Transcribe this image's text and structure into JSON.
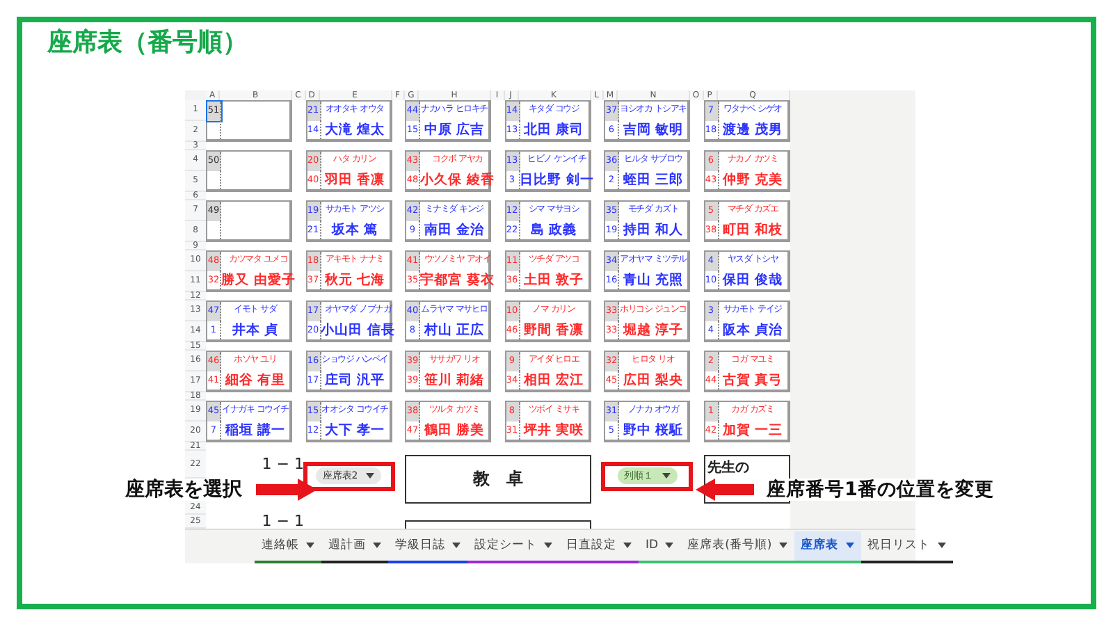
{
  "title": "座席表（番号順）",
  "sheet": {
    "columns": [
      "A",
      "B",
      "C",
      "D",
      "E",
      "F",
      "G",
      "H",
      "I",
      "J",
      "K",
      "L",
      "M",
      "N",
      "O",
      "P",
      "Q"
    ],
    "row_numbers": [
      "1",
      "2",
      "3",
      "4",
      "5",
      "6",
      "7",
      "8",
      "9",
      "10",
      "11",
      "12",
      "13",
      "14",
      "15",
      "16",
      "17",
      "18",
      "19",
      "20",
      "21",
      "22",
      "24",
      "25"
    ],
    "seat_columns": [
      {
        "seats": [
          {
            "kind": "empty",
            "seat_no": "51"
          },
          {
            "kind": "empty",
            "seat_no": "50"
          },
          {
            "kind": "empty",
            "seat_no": "49"
          },
          {
            "kind": "student",
            "seat_no": "48",
            "kana": "カツマタ ユメコ",
            "name": "勝又 由愛子",
            "student_no": "32",
            "color": "#ff2a2a"
          },
          {
            "kind": "student",
            "seat_no": "47",
            "kana": "イモト サダ",
            "name": "井本 貞",
            "student_no": "1",
            "color": "#2b33ff"
          },
          {
            "kind": "student",
            "seat_no": "46",
            "kana": "ホソヤ ユリ",
            "name": "細谷 有里",
            "student_no": "41",
            "color": "#ff2a2a"
          },
          {
            "kind": "student",
            "seat_no": "45",
            "kana": "イナガキ コウイチ",
            "name": "稲垣 講一",
            "student_no": "7",
            "color": "#2b33ff"
          }
        ]
      },
      {
        "seats": [
          {
            "kind": "student",
            "seat_no": "21",
            "kana": "オオタキ オウタ",
            "name": "大滝 煌太",
            "student_no": "14",
            "color": "#2b33ff"
          },
          {
            "kind": "student",
            "seat_no": "20",
            "kana": "ハタ カリン",
            "name": "羽田 香凛",
            "student_no": "40",
            "color": "#ff2a2a"
          },
          {
            "kind": "student",
            "seat_no": "19",
            "kana": "サカモト アツシ",
            "name": "坂本 篤",
            "student_no": "21",
            "color": "#2b33ff"
          },
          {
            "kind": "student",
            "seat_no": "18",
            "kana": "アキモト ナナミ",
            "name": "秋元 七海",
            "student_no": "37",
            "color": "#ff2a2a"
          },
          {
            "kind": "student",
            "seat_no": "17",
            "kana": "オヤマダ ノブナガ",
            "name": "小山田 信長",
            "student_no": "20",
            "color": "#2b33ff"
          },
          {
            "kind": "student",
            "seat_no": "16",
            "kana": "ショウジ ハンペイ",
            "name": "庄司 汎平",
            "student_no": "17",
            "color": "#2b33ff"
          },
          {
            "kind": "student",
            "seat_no": "15",
            "kana": "オオシタ コウイチ",
            "name": "大下 孝一",
            "student_no": "12",
            "color": "#2b33ff"
          }
        ]
      },
      {
        "seats": [
          {
            "kind": "student",
            "seat_no": "44",
            "kana": "ナカハラ ヒロキチ",
            "name": "中原 広吉",
            "student_no": "15",
            "color": "#2b33ff"
          },
          {
            "kind": "student",
            "seat_no": "43",
            "kana": "コクボ アヤカ",
            "name": "小久保 綾香",
            "student_no": "48",
            "color": "#ff2a2a"
          },
          {
            "kind": "student",
            "seat_no": "42",
            "kana": "ミナミダ キンジ",
            "name": "南田 金治",
            "student_no": "9",
            "color": "#2b33ff"
          },
          {
            "kind": "student",
            "seat_no": "41",
            "kana": "ウツノミヤ アオイ",
            "name": "宇都宮 葵衣",
            "student_no": "35",
            "color": "#ff2a2a"
          },
          {
            "kind": "student",
            "seat_no": "40",
            "kana": "ムラヤマ マサヒロ",
            "name": "村山 正広",
            "student_no": "8",
            "color": "#2b33ff"
          },
          {
            "kind": "student",
            "seat_no": "39",
            "kana": "ササガワ リオ",
            "name": "笹川 莉緒",
            "student_no": "39",
            "color": "#ff2a2a"
          },
          {
            "kind": "student",
            "seat_no": "38",
            "kana": "ツルタ カツミ",
            "name": "鶴田 勝美",
            "student_no": "47",
            "color": "#ff2a2a"
          }
        ]
      },
      {
        "seats": [
          {
            "kind": "student",
            "seat_no": "14",
            "kana": "キタダ コウジ",
            "name": "北田 康司",
            "student_no": "13",
            "color": "#2b33ff"
          },
          {
            "kind": "student",
            "seat_no": "13",
            "kana": "ヒビノ ケンイチ",
            "name": "日比野 剣一",
            "student_no": "3",
            "color": "#2b33ff"
          },
          {
            "kind": "student",
            "seat_no": "12",
            "kana": "シマ マサヨシ",
            "name": "島 政義",
            "student_no": "22",
            "color": "#2b33ff"
          },
          {
            "kind": "student",
            "seat_no": "11",
            "kana": "ツチダ アツコ",
            "name": "土田 敦子",
            "student_no": "36",
            "color": "#ff2a2a"
          },
          {
            "kind": "student",
            "seat_no": "10",
            "kana": "ノマ カリン",
            "name": "野間 香凛",
            "student_no": "46",
            "color": "#ff2a2a"
          },
          {
            "kind": "student",
            "seat_no": "9",
            "kana": "アイダ ヒロエ",
            "name": "相田 宏江",
            "student_no": "34",
            "color": "#ff2a2a"
          },
          {
            "kind": "student",
            "seat_no": "8",
            "kana": "ツボイ ミサキ",
            "name": "坪井 実咲",
            "student_no": "31",
            "color": "#ff2a2a"
          }
        ]
      },
      {
        "seats": [
          {
            "kind": "student",
            "seat_no": "37",
            "kana": "ヨシオカ トシアキ",
            "name": "吉岡 敏明",
            "student_no": "6",
            "color": "#2b33ff"
          },
          {
            "kind": "student",
            "seat_no": "36",
            "kana": "ヒルタ サブロウ",
            "name": "蛭田 三郎",
            "student_no": "2",
            "color": "#2b33ff"
          },
          {
            "kind": "student",
            "seat_no": "35",
            "kana": "モチダ カズト",
            "name": "持田 和人",
            "student_no": "19",
            "color": "#2b33ff"
          },
          {
            "kind": "student",
            "seat_no": "34",
            "kana": "アオヤマ ミツテル",
            "name": "青山 充照",
            "student_no": "16",
            "color": "#2b33ff"
          },
          {
            "kind": "student",
            "seat_no": "33",
            "kana": "ホリコシ ジュンコ",
            "name": "堀越 淳子",
            "student_no": "33",
            "color": "#ff2a2a"
          },
          {
            "kind": "student",
            "seat_no": "32",
            "kana": "ヒロタ リオ",
            "name": "広田 梨央",
            "student_no": "45",
            "color": "#ff2a2a"
          },
          {
            "kind": "student",
            "seat_no": "31",
            "kana": "ノナカ オウガ",
            "name": "野中 桜駈",
            "student_no": "5",
            "color": "#2b33ff"
          }
        ]
      },
      {
        "seats": [
          {
            "kind": "student",
            "seat_no": "7",
            "kana": "ワタナベ シゲオ",
            "name": "渡邊 茂男",
            "student_no": "18",
            "color": "#2b33ff"
          },
          {
            "kind": "student",
            "seat_no": "6",
            "kana": "ナカノ カツミ",
            "name": "仲野 克美",
            "student_no": "43",
            "color": "#ff2a2a"
          },
          {
            "kind": "student",
            "seat_no": "5",
            "kana": "マチダ カズエ",
            "name": "町田 和枝",
            "student_no": "38",
            "color": "#ff2a2a"
          },
          {
            "kind": "student",
            "seat_no": "4",
            "kana": "ヤスダ トシヤ",
            "name": "保田 俊哉",
            "student_no": "10",
            "color": "#2b33ff"
          },
          {
            "kind": "student",
            "seat_no": "3",
            "kana": "サカモト テイジ",
            "name": "阪本 貞治",
            "student_no": "4",
            "color": "#2b33ff"
          },
          {
            "kind": "student",
            "seat_no": "2",
            "kana": "コガ マユミ",
            "name": "古賀 真弓",
            "student_no": "44",
            "color": "#ff2a2a"
          },
          {
            "kind": "student",
            "seat_no": "1",
            "kana": "カガ カズミ",
            "name": "加賀 一三",
            "student_no": "42",
            "color": "#ff2a2a"
          }
        ]
      }
    ],
    "class_labels": [
      "1 − 1",
      "1 − 1"
    ],
    "seat_dropdown": {
      "value": "座席表2"
    },
    "desk": "教　卓",
    "order_dropdown": {
      "value": "列順１"
    },
    "teacher_box": "先生の"
  },
  "callouts": [
    {
      "text": "座席表を選択"
    },
    {
      "text": "座席番号1番の位置を変更"
    }
  ],
  "tabs": [
    {
      "label": "連絡帳",
      "selected": false,
      "color": "#2e7d32"
    },
    {
      "label": "週計画",
      "selected": false,
      "color": "#222222"
    },
    {
      "label": "学級日誌",
      "selected": false,
      "color": "#1a3ee8"
    },
    {
      "label": "設定シート",
      "selected": false,
      "color": "#9c27d8"
    },
    {
      "label": "日直設定",
      "selected": false,
      "color": "#9c27d8"
    },
    {
      "label": "ID",
      "selected": false,
      "color": "#3cc070"
    },
    {
      "label": "座席表(番号順)",
      "selected": false,
      "color": "#3cc070"
    },
    {
      "label": "座席表",
      "selected": true,
      "color": "#3cc070"
    },
    {
      "label": "祝日リスト",
      "selected": false,
      "color": "#222222"
    }
  ]
}
